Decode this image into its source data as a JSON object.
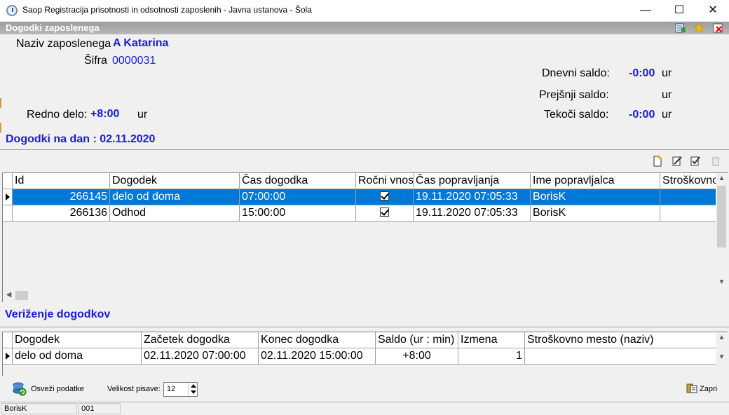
{
  "window": {
    "title": "Saop Registracija prisotnosti in odsotnosti zaposlenih - Javna ustanova - Šola",
    "minimize": "—",
    "maximize": "☐",
    "close": "✕"
  },
  "form": {
    "header": "Dogodki zaposlenega",
    "employee_name_label": "Naziv zaposlenega",
    "employee_name": "A Katarina",
    "code_label": "Šifra",
    "code": "0000031",
    "regular_work_label": "Redno delo:",
    "regular_work_value": "+8:00",
    "regular_work_unit": "ur",
    "daily_balance_label": "Dnevni saldo:",
    "daily_balance_value": "-0:00",
    "daily_balance_unit": "ur",
    "prev_balance_label": "Prejšnji saldo:",
    "prev_balance_value": "",
    "prev_balance_unit": "ur",
    "current_balance_label": "Tekoči saldo:",
    "current_balance_value": "-0:00",
    "current_balance_unit": "ur"
  },
  "events_section": {
    "title": "Dogodki na dan : 02.11.2020",
    "columns": [
      "Id",
      "Dogodek",
      "Čas dogodka",
      "Ročni vnos",
      "Čas popravljanja",
      "Ime popravljalca",
      "Stroškovno"
    ],
    "rows": [
      {
        "id": "266145",
        "event": "delo od doma",
        "time": "07:00:00",
        "manual": true,
        "corrected": "19.11.2020 07:05:33",
        "corrector": "BorisK",
        "cost": ""
      },
      {
        "id": "266136",
        "event": "Odhod",
        "time": "15:00:00",
        "manual": true,
        "corrected": "19.11.2020 07:05:33",
        "corrector": "BorisK",
        "cost": ""
      }
    ]
  },
  "chain_section": {
    "title": "Veriženje dogodkov",
    "columns": [
      "Dogodek",
      "Začetek dogodka",
      "Konec dogodka",
      "Saldo (ur : min)",
      "Izmena",
      "Stroškovno mesto (naziv)"
    ],
    "rows": [
      {
        "event": "delo od doma",
        "start": "02.11.2020 07:00:00",
        "end": "02.11.2020 15:00:00",
        "balance": "+8:00",
        "shift": "1",
        "cost": ""
      }
    ]
  },
  "toolbar": {
    "refresh_label": "Osveži podatke",
    "font_size_label": "Velikost pisave:",
    "font_size_value": "12",
    "close_label": "Zapri"
  },
  "status": {
    "user": "BorisK",
    "code": "001"
  },
  "colors": {
    "accent_blue": "#1a1adc",
    "selection": "#0078d7"
  }
}
